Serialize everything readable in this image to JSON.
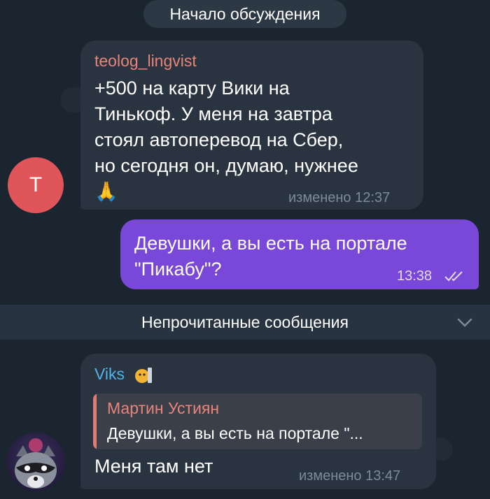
{
  "discussion_pill": "Начало обсуждения",
  "message1": {
    "sender": "teolog_lingvist",
    "sender_color": "#e8857a",
    "lines": [
      "+500 на карту Вики на",
      "Тинькоф. У меня на завтра",
      "стоял автоперевод на Сбер,",
      "но сегодня он, думаю, нужнее"
    ],
    "emoji": "🙏",
    "meta": "изменено 12:37",
    "avatar_letter": "T",
    "avatar_color": "#e0555a"
  },
  "message2": {
    "lines": [
      "Девушки, а вы есть на портале",
      "\"Пикабу\"?"
    ],
    "time": "13:38",
    "status_icon": "double-check-icon",
    "bubble_color": "#7a48d8"
  },
  "unread_divider": "Непрочитанные сообщения",
  "message3": {
    "sender": "Viks",
    "sender_color": "#4fb3e8",
    "reply_author": "Мартин Устиян",
    "reply_text": "Девушки, а вы есть на портале \"...",
    "text": "Меня там нет",
    "meta": "изменено 13:47",
    "avatar": "raccoon-avatar"
  }
}
